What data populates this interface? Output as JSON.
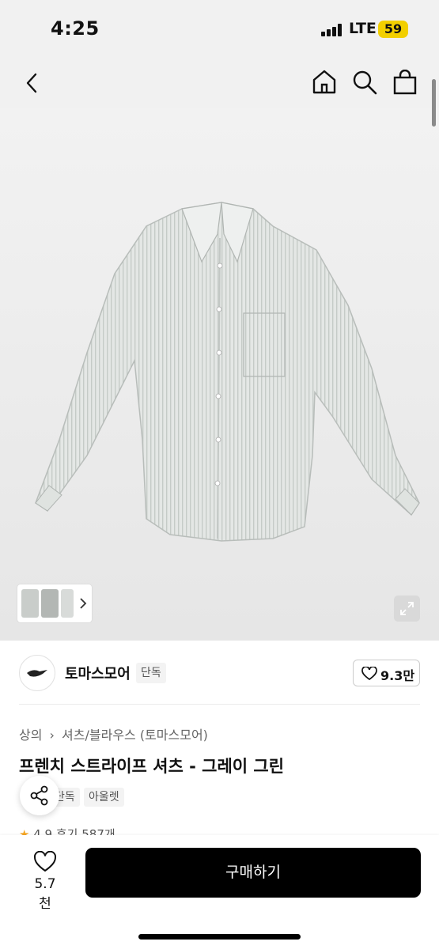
{
  "status_bar": {
    "time": "4:25",
    "network": "LTE",
    "battery": "59"
  },
  "nav": {
    "icons": [
      "back-icon",
      "home-icon",
      "search-icon",
      "bag-icon"
    ]
  },
  "brand": {
    "name": "토마스모어",
    "exclusive_label": "단독",
    "likes": "9.3만"
  },
  "breadcrumb": [
    "상의",
    "셔츠/블라우스 (토마스모어)"
  ],
  "product": {
    "title": "프렌치 스트라이프 셔츠 - 그레이 그린",
    "tags": [
      "단독",
      "아울렛"
    ],
    "rating": "4.9",
    "reviews": "후기 587개"
  },
  "bottom_bar": {
    "wish_count": "5.7천",
    "buy_label": "구매하기"
  },
  "colors": {
    "accent": "#000000",
    "battery": "#f2cf00",
    "star": "#f5a623"
  }
}
